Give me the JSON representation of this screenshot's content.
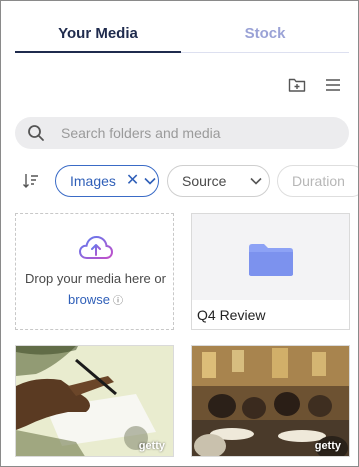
{
  "tabs": {
    "your_media": "Your Media",
    "stock": "Stock",
    "active": "Your Media"
  },
  "toolbar": {
    "new_folder_icon": "folder-plus-icon",
    "menu_icon": "hamburger-menu-icon"
  },
  "search": {
    "placeholder": "Search folders and media",
    "value": ""
  },
  "filters": {
    "sort_icon": "sort-icon",
    "images": "Images",
    "source": "Source",
    "duration": "Duration"
  },
  "drop_zone": {
    "text": "Drop your media here or",
    "browse": "browse"
  },
  "folders": [
    {
      "name": "Q4 Review"
    }
  ],
  "media": [
    {
      "badge": "getty",
      "subject": "hand signing document"
    },
    {
      "badge": "getty",
      "subject": "people at restaurant"
    }
  ],
  "colors": {
    "accent": "#2f5fb8",
    "tab_active": "#1f2b4d",
    "tab_inactive": "#9aa2d6",
    "upload_icon": "#8a5cd8",
    "folder": "#8da2f5"
  }
}
